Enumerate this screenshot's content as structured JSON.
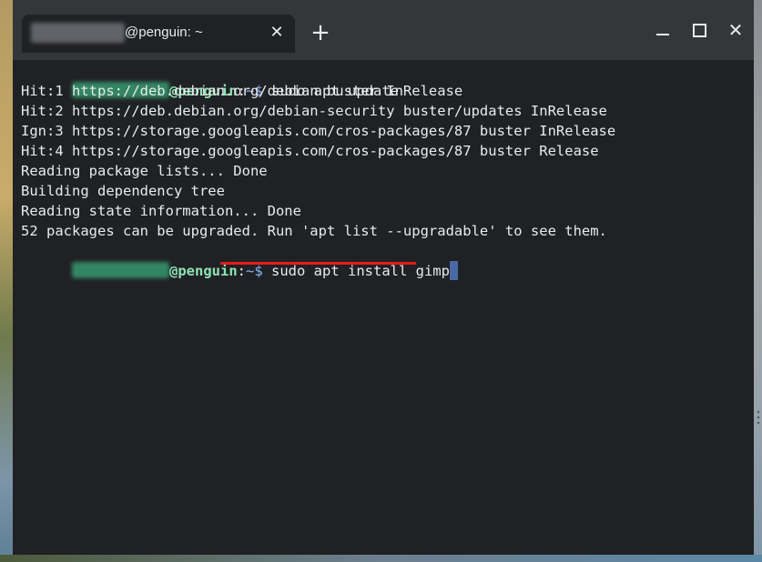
{
  "tab": {
    "title": "@penguin: ~",
    "close_label": "✕"
  },
  "new_tab_label": "+",
  "window_controls": {
    "close_label": "✕"
  },
  "terminal": {
    "prompt_host": "@penguin",
    "prompt_sep": ":",
    "prompt_path": "~$",
    "command_1": " sudo apt update",
    "output": [
      "Hit:1 https://deb.debian.org/debian buster InRelease",
      "Hit:2 https://deb.debian.org/debian-security buster/updates InRelease",
      "Ign:3 https://storage.googleapis.com/cros-packages/87 buster InRelease",
      "Hit:4 https://storage.googleapis.com/cros-packages/87 buster Release",
      "Reading package lists... Done",
      "Building dependency tree",
      "Reading state information... Done",
      "52 packages can be upgraded. Run 'apt list --upgradable' to see them."
    ],
    "command_2": " sudo apt install gimp"
  },
  "colors": {
    "terminal_bg": "#202124",
    "titlebar_bg": "#35363a",
    "prompt_host": "#8ee2b4",
    "prompt_path": "#8ab4f8",
    "highlight_underline": "#e51c1c",
    "cursor": "#4a6aa6"
  }
}
